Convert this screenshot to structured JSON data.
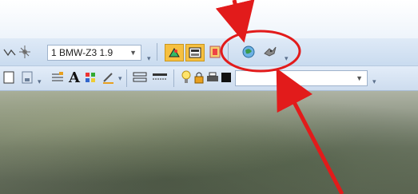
{
  "toolbar1": {
    "render_mode_value": "1 BMW-Z3 1.9",
    "icons": [
      "polyline-icon",
      "light-icon",
      "render-icon",
      "material-icon",
      "texture-icon",
      "globe-icon",
      "bird-icon"
    ]
  },
  "toolbar2": {
    "text_icon_glyph": "A",
    "icons": [
      "layer-icon",
      "frame-icon",
      "paint-icon",
      "pen-icon",
      "stack-icon",
      "line-icon",
      "bulb-icon",
      "camera-icon",
      "print-icon"
    ]
  },
  "annotations": {
    "highlight_color": "#e21b1b",
    "arrow_color": "#e21b1b"
  }
}
